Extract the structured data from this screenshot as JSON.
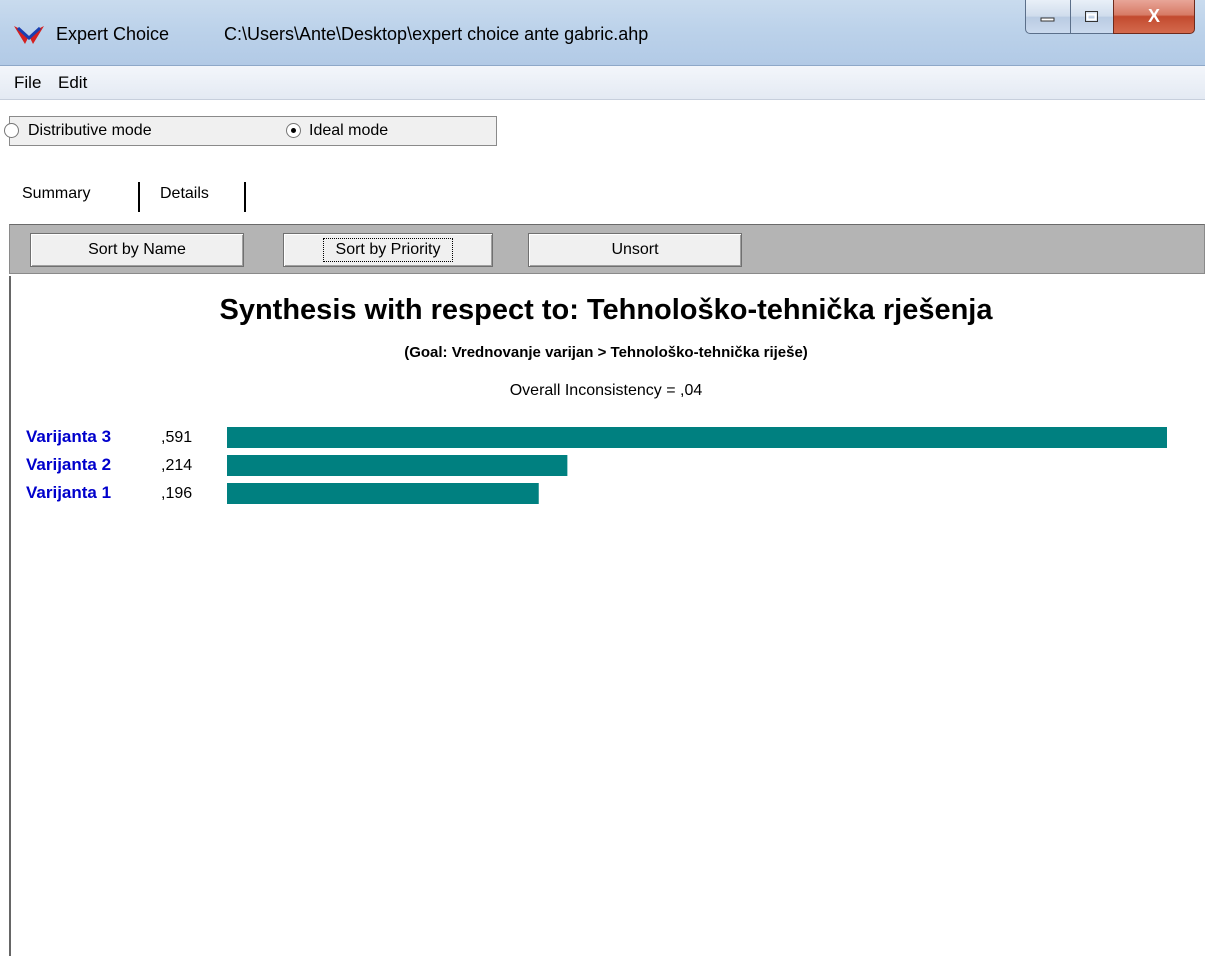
{
  "window": {
    "app_name": "Expert Choice",
    "file_path": "C:\\Users\\Ante\\Desktop\\expert choice ante gabric.ahp",
    "close_glyph": "X"
  },
  "menu": {
    "file": "File",
    "edit": "Edit"
  },
  "modes": {
    "distributive": "Distributive mode",
    "ideal": "Ideal mode",
    "selected": "ideal"
  },
  "tabs": {
    "summary": "Summary",
    "details": "Details"
  },
  "toolbar": {
    "sort_name": "Sort by Name",
    "sort_priority": "Sort by Priority",
    "unsort": "Unsort"
  },
  "colors": {
    "bar": "#008080",
    "label": "#0000cc"
  },
  "chart_data": {
    "type": "bar",
    "orientation": "horizontal",
    "title": "Synthesis with respect to: Tehnološko-tehnička rješenja",
    "subtitle": "(Goal: Vrednovanje varijan > Tehnološko-tehnička riješe)",
    "inconsistency": "Overall Inconsistency = ,04",
    "categories": [
      "Varijanta 3",
      "Varijanta 2",
      "Varijanta 1"
    ],
    "values": [
      0.591,
      0.214,
      0.196
    ],
    "value_labels": [
      ",591",
      ",214",
      ",196"
    ]
  }
}
